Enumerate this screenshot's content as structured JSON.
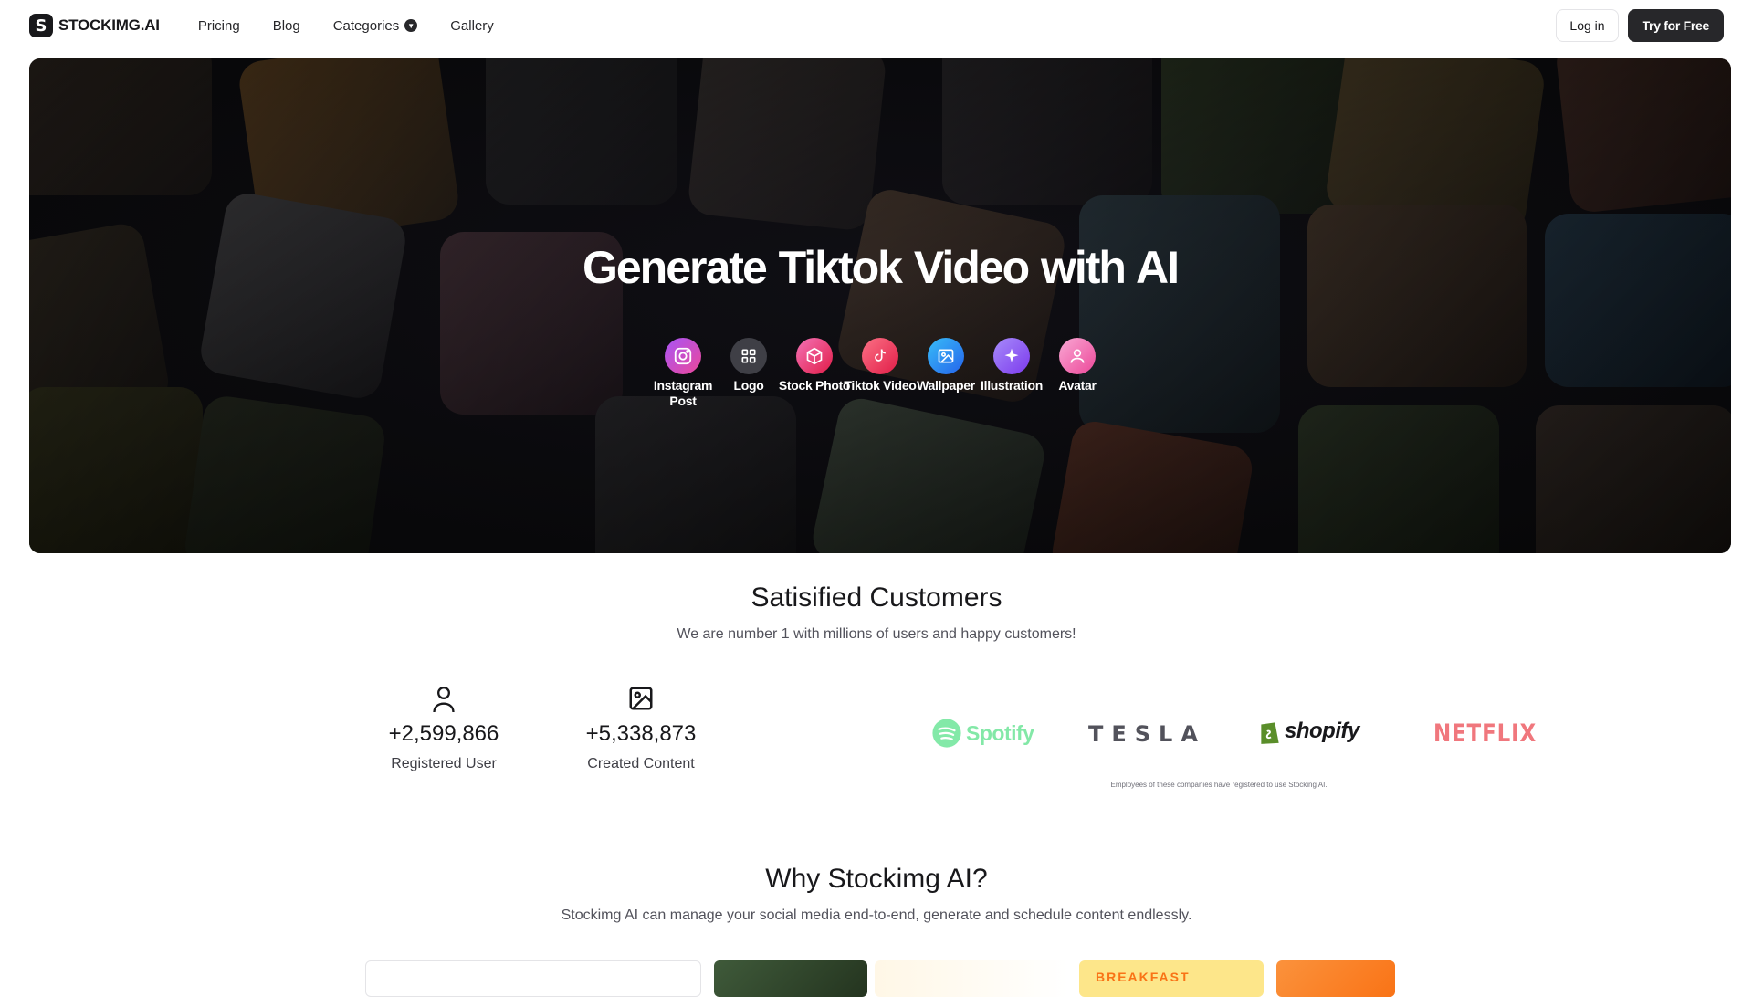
{
  "nav": {
    "brand": "STOCKIMG.AI",
    "brand_glyph": "S",
    "links": [
      {
        "label": "Pricing"
      },
      {
        "label": "Blog"
      },
      {
        "label": "Categories",
        "has_dropdown": true
      },
      {
        "label": "Gallery"
      }
    ],
    "login": "Log in",
    "try_free": "Try for Free"
  },
  "hero": {
    "title": "Generate Tiktok Video  with AI",
    "categories": [
      {
        "label": "Instagram Post",
        "icon": "instagram-icon",
        "color": "#c026d3"
      },
      {
        "label": "Logo",
        "icon": "grid-icon",
        "color": "#3f3f46"
      },
      {
        "label": "Stock Photo",
        "icon": "box-icon",
        "color": "#ec4899"
      },
      {
        "label": "Tiktok Video",
        "icon": "tiktok-icon",
        "color": "#f43f5e"
      },
      {
        "label": "Wallpaper",
        "icon": "image-icon",
        "color": "#3b82f6"
      },
      {
        "label": "Illustration",
        "icon": "sparkle-icon",
        "color": "#8b5cf6"
      },
      {
        "label": "Avatar",
        "icon": "user-icon",
        "color": "#f472b6"
      }
    ]
  },
  "customers": {
    "title": "Satisified Customers",
    "subtitle": "We are number 1 with millions of users and happy customers!",
    "stats": [
      {
        "value": "+2,599,866",
        "label": "Registered User",
        "icon": "user-icon"
      },
      {
        "value": "+5,338,873",
        "label": "Created Content",
        "icon": "image-icon"
      }
    ],
    "brands": [
      "Spotify",
      "TESLA",
      "shopify",
      "NETFLIX"
    ],
    "brand_note": "Employees of these companies have registered to use Stocking AI."
  },
  "why": {
    "title": "Why Stockimg AI?",
    "subtitle": "Stockimg AI can manage your social media end-to-end, generate and schedule content endlessly.",
    "card_text": "BREAKFAST"
  },
  "colors": {
    "spotify": "#1ed760",
    "shopify": "#5a8e2a",
    "netflix": "#e50914",
    "dark": "#27272a"
  }
}
